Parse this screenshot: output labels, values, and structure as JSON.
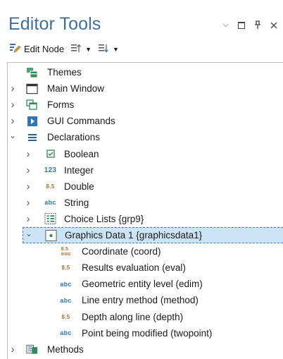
{
  "panel": {
    "title": "Editor Tools",
    "controls": {
      "dropdown": "⌄",
      "pin": "ᛘ",
      "close": "✕"
    }
  },
  "toolbar": {
    "edit_node_label": "Edit Node"
  },
  "tree": [
    {
      "id": "themes",
      "label": "Themes",
      "level": 0,
      "expander": "",
      "icon": "themes-icon"
    },
    {
      "id": "main-window",
      "label": "Main Window",
      "level": 0,
      "expander": ">",
      "icon": "window-icon"
    },
    {
      "id": "forms",
      "label": "Forms",
      "level": 0,
      "expander": ">",
      "icon": "forms-icon"
    },
    {
      "id": "gui-commands",
      "label": "GUI Commands",
      "level": 0,
      "expander": ">",
      "icon": "gui-commands-icon"
    },
    {
      "id": "declarations",
      "label": "Declarations",
      "level": 0,
      "expander": "⌄",
      "icon": "declarations-icon"
    },
    {
      "id": "boolean",
      "label": "Boolean",
      "level": 1,
      "expander": ">",
      "icon": "boolean-icon",
      "glyph": "☑"
    },
    {
      "id": "integer",
      "label": "Integer",
      "level": 1,
      "expander": ">",
      "icon": "integer-icon",
      "glyph": "123"
    },
    {
      "id": "double",
      "label": "Double",
      "level": 1,
      "expander": ">",
      "icon": "double-icon",
      "glyph": "8.5"
    },
    {
      "id": "string",
      "label": "String",
      "level": 1,
      "expander": ">",
      "icon": "string-icon",
      "glyph": "abc"
    },
    {
      "id": "choice-lists",
      "label": "Choice Lists {grp9}",
      "level": 1,
      "expander": ">",
      "icon": "choice-list-icon"
    },
    {
      "id": "graphics-data",
      "label": "Graphics Data 1 {graphicsdata1}",
      "level": 1,
      "expander": "⌄",
      "icon": "graphics-data-icon",
      "selected": true
    },
    {
      "id": "coordinate",
      "label": "Coordinate (coord)",
      "level": 2,
      "expander": "",
      "icon": "coordinate-icon",
      "glyph": "8.5"
    },
    {
      "id": "results-eval",
      "label": "Results evaluation (eval)",
      "level": 2,
      "expander": "",
      "icon": "double-icon",
      "glyph": "8.5"
    },
    {
      "id": "geom-entity",
      "label": "Geometric entity level (edim)",
      "level": 2,
      "expander": "",
      "icon": "string-icon",
      "glyph": "abc"
    },
    {
      "id": "line-entry",
      "label": "Line entry method (method)",
      "level": 2,
      "expander": "",
      "icon": "string-icon",
      "glyph": "abc"
    },
    {
      "id": "depth",
      "label": "Depth along line (depth)",
      "level": 2,
      "expander": "",
      "icon": "double-icon",
      "glyph": "8.5"
    },
    {
      "id": "point-mod",
      "label": "Point being modified (twopoint)",
      "level": 2,
      "expander": "",
      "icon": "string-icon",
      "glyph": "abc"
    },
    {
      "id": "methods",
      "label": "Methods",
      "level": 0,
      "expander": ">",
      "icon": "methods-icon"
    }
  ]
}
